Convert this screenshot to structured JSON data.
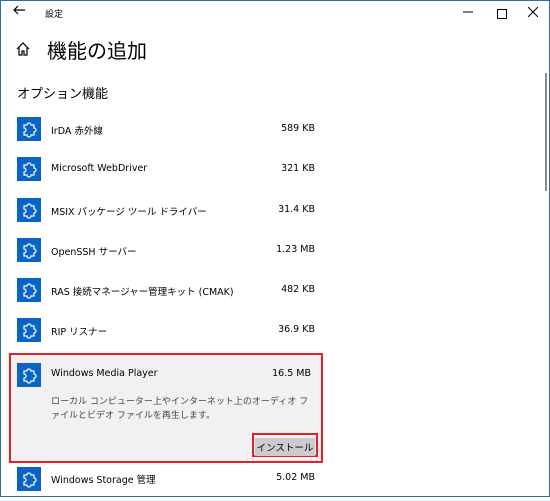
{
  "window": {
    "title": "設定"
  },
  "header": {
    "title": "機能の追加"
  },
  "section": {
    "title": "オプション機能"
  },
  "features": [
    {
      "name": "IrDA 赤外線",
      "size": "589 KB"
    },
    {
      "name": "Microsoft WebDriver",
      "size": "321 KB"
    },
    {
      "name": "MSIX パッケージ ツール ドライバー",
      "size": "31.4 KB"
    },
    {
      "name": "OpenSSH サーバー",
      "size": "1.23 MB"
    },
    {
      "name": "RAS 接続マネージャー管理キット (CMAK)",
      "size": "482 KB"
    },
    {
      "name": "RIP リスナー",
      "size": "36.9 KB"
    }
  ],
  "selected": {
    "name": "Windows Media Player",
    "size": "16.5 MB",
    "description": "ローカル コンピューター上やインターネット上のオーディオ ファイルとビデオ ファイルを再生します。",
    "install_label": "インストール"
  },
  "next": {
    "name": "Windows Storage 管理",
    "size": "5.02 MB"
  },
  "colors": {
    "accent": "#0a64c8",
    "highlight": "#e0202c",
    "selected_bg": "#f1f1f1"
  },
  "icons": {
    "feature": "puzzle-gear-icon",
    "home": "home-icon",
    "back": "back-arrow-icon"
  }
}
